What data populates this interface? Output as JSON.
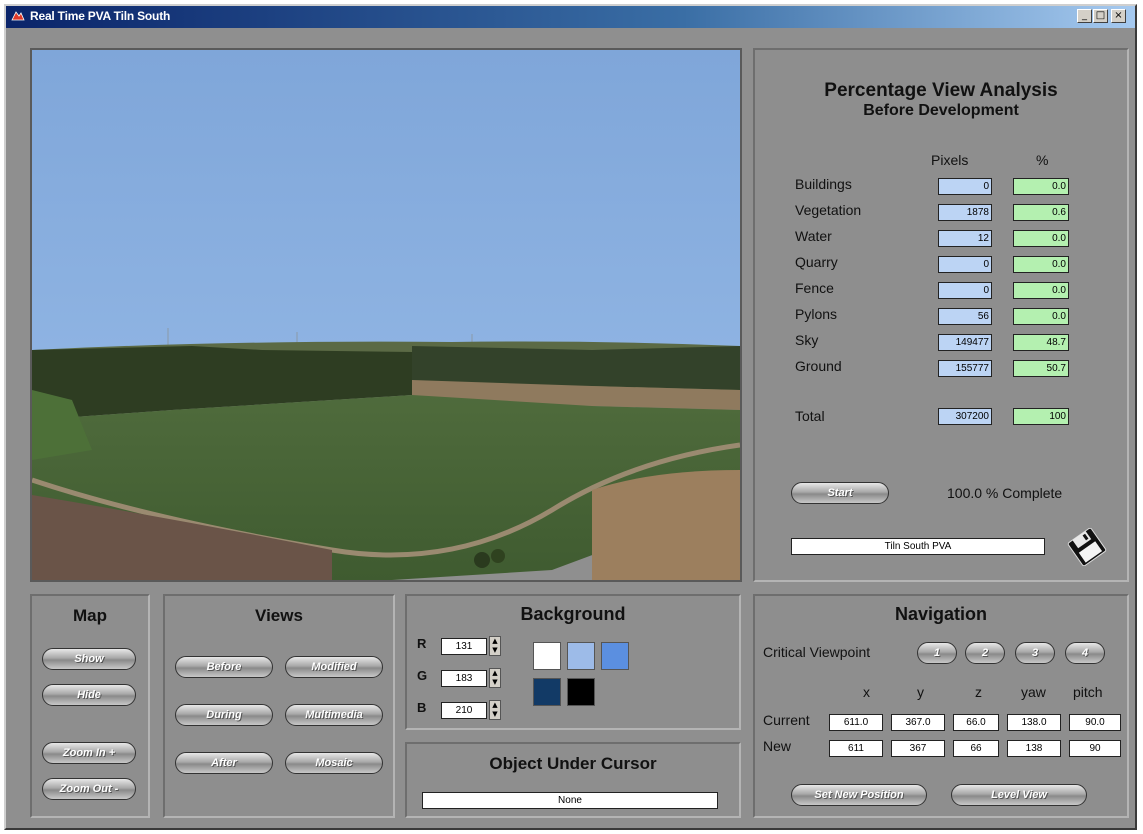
{
  "window": {
    "title": "Real Time PVA Tiln South",
    "min_glyph": "_",
    "max_glyph": "□",
    "close_glyph": "×"
  },
  "pva": {
    "title": "Percentage View Analysis",
    "subtitle": "Before Development",
    "col_pixels": "Pixels",
    "col_percent": "%",
    "rows": [
      {
        "label": "Buildings",
        "pixels": "0",
        "percent": "0.0"
      },
      {
        "label": "Vegetation",
        "pixels": "1878",
        "percent": "0.6"
      },
      {
        "label": "Water",
        "pixels": "12",
        "percent": "0.0"
      },
      {
        "label": "Quarry",
        "pixels": "0",
        "percent": "0.0"
      },
      {
        "label": "Fence",
        "pixels": "0",
        "percent": "0.0"
      },
      {
        "label": "Pylons",
        "pixels": "56",
        "percent": "0.0"
      },
      {
        "label": "Sky",
        "pixels": "149477",
        "percent": "48.7"
      },
      {
        "label": "Ground",
        "pixels": "155777",
        "percent": "50.7"
      }
    ],
    "total_label": "Total",
    "total_pixels": "307200",
    "total_percent": "100",
    "start_label": "Start",
    "complete_text": "100.0 % Complete",
    "filename": "Tiln South PVA"
  },
  "map": {
    "title": "Map",
    "show": "Show",
    "hide": "Hide",
    "zoom_in": "Zoom In +",
    "zoom_out": "Zoom Out -"
  },
  "views": {
    "title": "Views",
    "before": "Before",
    "modified": "Modified",
    "during": "During",
    "multimedia": "Multimedia",
    "after": "After",
    "mosaic": "Mosaic"
  },
  "background": {
    "title": "Background",
    "r_label": "R",
    "g_label": "G",
    "b_label": "B",
    "r": "131",
    "g": "183",
    "b": "210",
    "swatches": [
      "#ffffff",
      "#9dbbe8",
      "#5b8fe0",
      "#123a66",
      "#000000"
    ]
  },
  "object": {
    "title": "Object Under Cursor",
    "value": "None"
  },
  "navigation": {
    "title": "Navigation",
    "cv_label": "Critical Viewpoint",
    "cv_buttons": [
      "1",
      "2",
      "3",
      "4"
    ],
    "col_x": "x",
    "col_y": "y",
    "col_z": "z",
    "col_yaw": "yaw",
    "col_pitch": "pitch",
    "current_label": "Current",
    "current": {
      "x": "611.0",
      "y": "367.0",
      "z": "66.0",
      "yaw": "138.0",
      "pitch": "90.0"
    },
    "new_label": "New",
    "new": {
      "x": "611",
      "y": "367",
      "z": "66",
      "yaw": "138",
      "pitch": "90"
    },
    "set_position": "Set New Position",
    "level_view": "Level View"
  }
}
